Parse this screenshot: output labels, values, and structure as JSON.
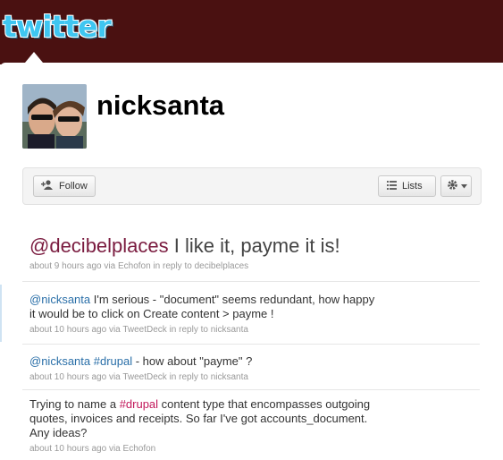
{
  "brand": {
    "logo_text": "twitter"
  },
  "profile": {
    "username": "nicksanta"
  },
  "actions": {
    "follow_label": "Follow",
    "lists_label": "Lists"
  },
  "tweets": [
    {
      "mention": "@decibelplaces",
      "text": " I like it, payme it is!",
      "meta": "about 9 hours ago via Echofon in reply to decibelplaces"
    },
    {
      "mention": "@nicksanta",
      "text_line1": " I'm serious - \"document\" seems redundant, how happy",
      "text_line2": "it would be to click on Create content > payme !",
      "meta": "about 10 hours ago via TweetDeck in reply to nicksanta"
    },
    {
      "mention": "@nicksanta",
      "hashtag": "#drupal",
      "text": " - how about \"payme\" ?",
      "meta": "about 10 hours ago via TweetDeck in reply to nicksanta"
    },
    {
      "text_pre": "Trying to name a ",
      "hashtag": "#drupal",
      "text_line1": " content type that encompasses outgoing",
      "text_line2": "quotes, invoices and receipts. So far I've got accounts_document.",
      "text_line3": "Any ideas?",
      "meta": "about 10 hours ago via Echofon"
    }
  ],
  "colors": {
    "topbar": "#4a1111",
    "logo": "#3fc6f1",
    "link": "#2a6fa8",
    "hashtag": "#c2185b"
  }
}
